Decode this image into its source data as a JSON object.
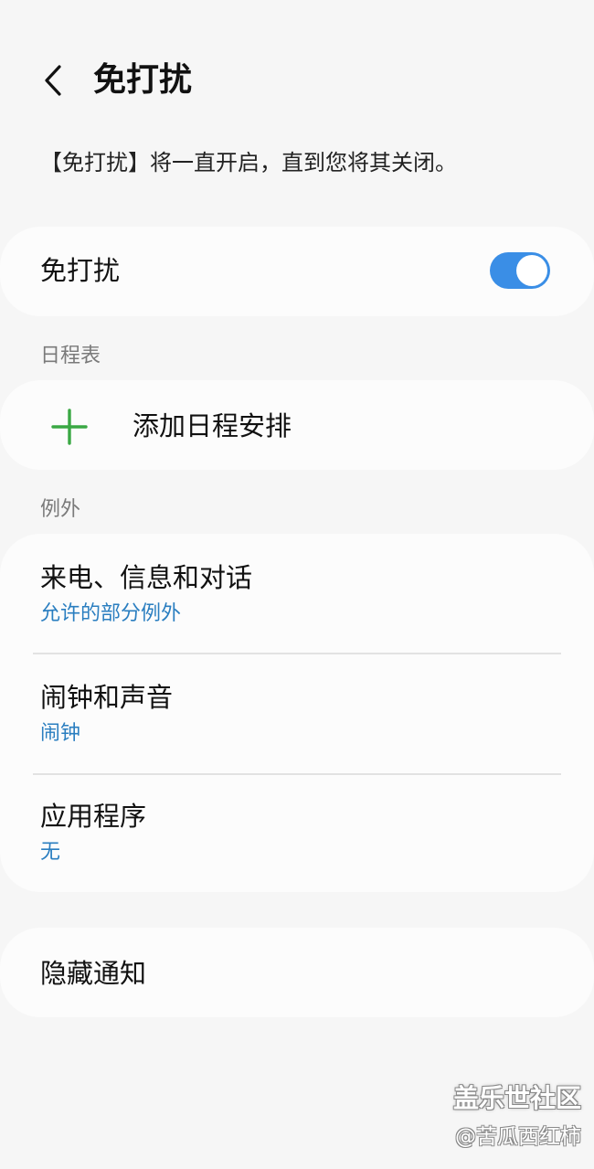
{
  "header": {
    "title": "免打扰",
    "back_icon": "chevron-left-icon"
  },
  "description": "【免打扰】将一直开启，直到您将其关闭。",
  "dnd_toggle": {
    "label": "免打扰",
    "on": true,
    "accent": "#3a8ee6"
  },
  "schedule": {
    "section_label": "日程表",
    "add_label": "添加日程安排",
    "add_icon": "plus-icon",
    "add_icon_color": "#3aa844"
  },
  "exceptions": {
    "section_label": "例外",
    "items": [
      {
        "title": "来电、信息和对话",
        "sub": "允许的部分例外"
      },
      {
        "title": "闹钟和声音",
        "sub": "闹钟"
      },
      {
        "title": "应用程序",
        "sub": "无"
      }
    ]
  },
  "hide_notifications": {
    "label": "隐藏通知"
  },
  "watermark": {
    "main": "盖乐世社区",
    "sub": "@苦瓜西红柿"
  }
}
